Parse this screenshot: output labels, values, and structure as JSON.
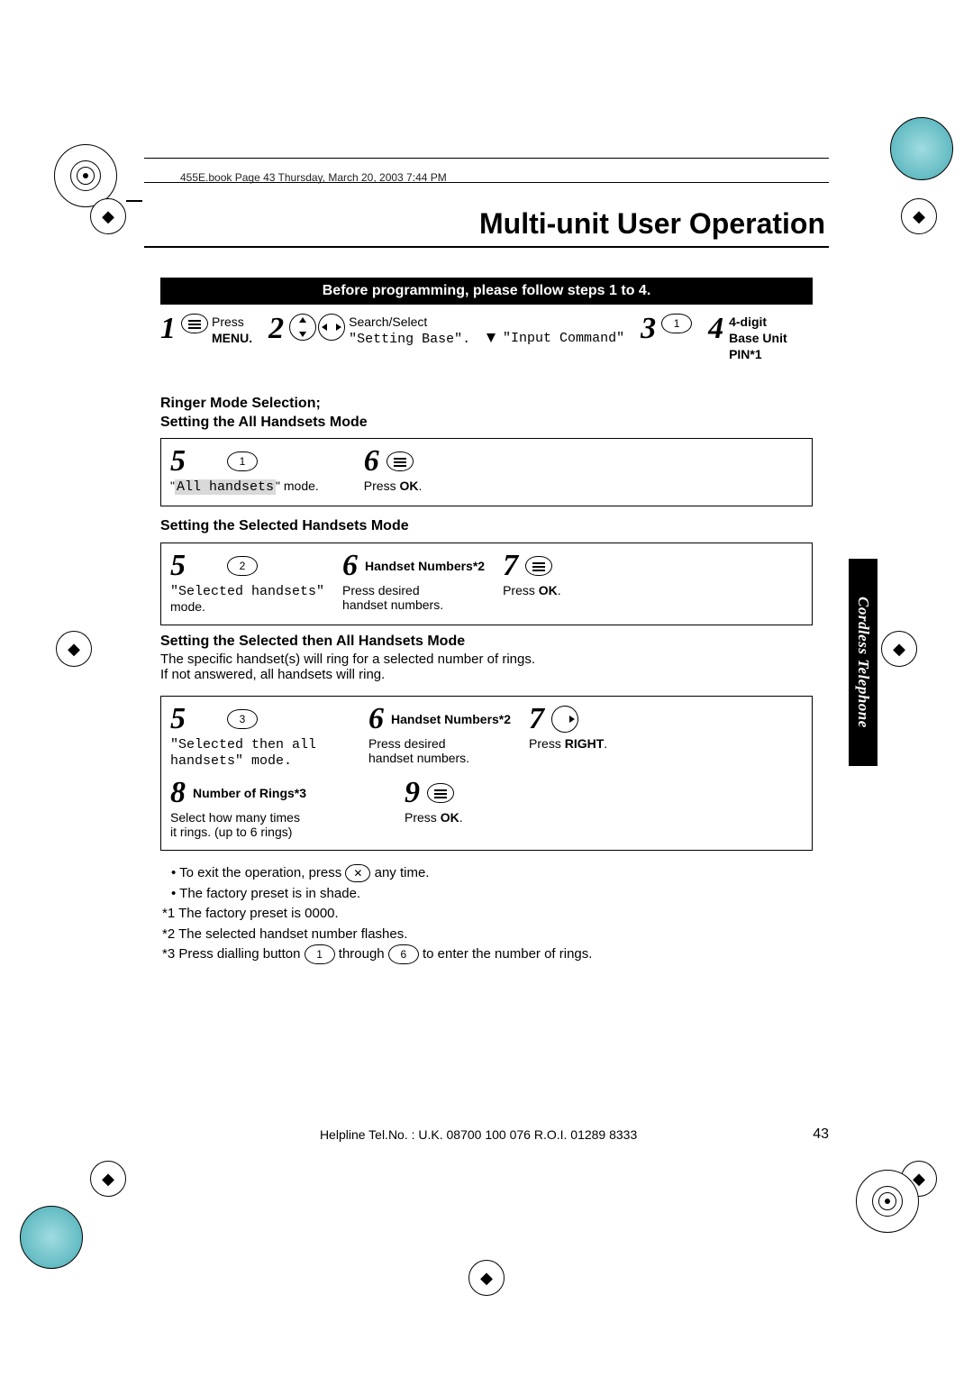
{
  "header_note": "455E.book  Page 43  Thursday, March 20, 2003  7:44 PM",
  "title": "Multi-unit User Operation",
  "banner": "Before programming, please follow steps 1 to 4.",
  "side_tab": "Cordless Telephone",
  "steps_common": {
    "s1": {
      "num": "1",
      "line1": "Press",
      "line2": "MENU."
    },
    "s2": {
      "num": "2",
      "line1": "Search/Select",
      "line2": "\"Setting Base\"."
    },
    "s2_arrow_text": "\"Input Command\"",
    "s3": {
      "num": "3"
    },
    "s4": {
      "num": "4",
      "line1": "4-digit",
      "line2": "Base Unit",
      "line3": "PIN*1"
    }
  },
  "headingA": {
    "l1": "Ringer Mode Selection;",
    "l2": "Setting the All Handsets Mode"
  },
  "boxA": {
    "s5": {
      "num": "5",
      "text": "\"All handsets\" mode.",
      "shaded_word": "All handsets",
      "key": "1"
    },
    "s6": {
      "num": "6",
      "text": "Press OK."
    }
  },
  "headingB": "Setting the Selected Handsets Mode",
  "boxB": {
    "s5": {
      "num": "5",
      "text1": "\"Selected handsets\"",
      "text2": "mode.",
      "key": "2"
    },
    "s6": {
      "num": "6",
      "title": "Handset Numbers*2",
      "text1": "Press desired",
      "text2": "handset numbers."
    },
    "s7": {
      "num": "7",
      "text": "Press OK."
    }
  },
  "headingC": {
    "l1": "Setting the Selected then All Handsets Mode",
    "l2": "The specific handset(s) will ring for a selected number of rings.",
    "l3": "If not answered, all handsets will ring."
  },
  "boxC": {
    "s5": {
      "num": "5",
      "text1": "\"Selected then all",
      "text2": "handsets\" mode.",
      "key": "3"
    },
    "s6": {
      "num": "6",
      "title": "Handset Numbers*2",
      "text1": "Press desired",
      "text2": "handset numbers."
    },
    "s7": {
      "num": "7",
      "text": "Press RIGHT."
    },
    "s8": {
      "num": "8",
      "title": "Number of Rings*3",
      "text1": "Select how many times",
      "text2": "it rings. (up to 6 rings)"
    },
    "s9": {
      "num": "9",
      "text": "Press OK."
    }
  },
  "notes": {
    "n1a": "To exit the operation, press ",
    "n1b": " any time.",
    "n2": "The factory preset is in shade.",
    "n3": "*1 The factory preset is 0000.",
    "n4": "*2 The selected handset number flashes.",
    "n5a": "*3 Press dialling button ",
    "n5b": " through ",
    "n5c": " to enter the number of rings.",
    "key1": "1",
    "key6": "6"
  },
  "footer": {
    "helpline": "Helpline Tel.No. : U.K. 08700 100 076   R.O.I. 01289 8333",
    "page": "43"
  }
}
